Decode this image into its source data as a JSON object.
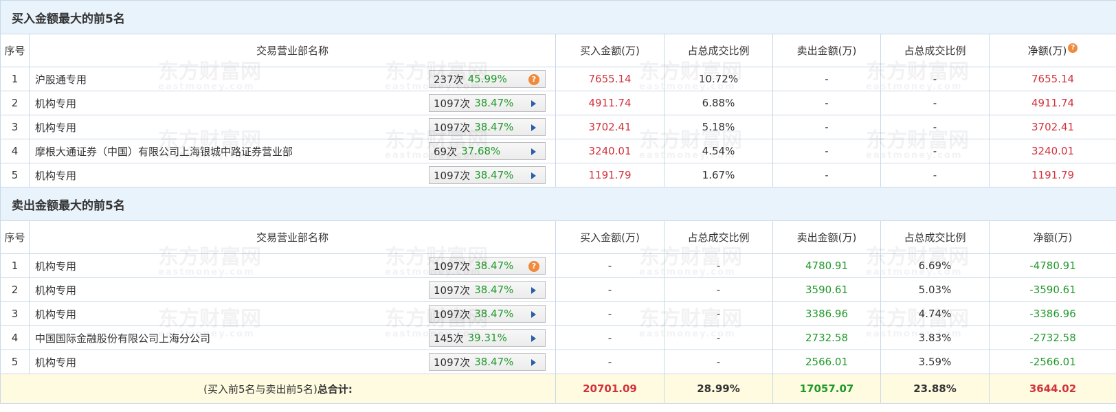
{
  "buy_section": {
    "title": "买入金额最大的前5名",
    "headers": [
      "序号",
      "交易营业部名称",
      "买入金额(万)",
      "占总成交比例",
      "卖出金额(万)",
      "占总成交比例",
      "净额(万)"
    ],
    "rows": [
      {
        "no": "1",
        "name": "沪股通专用",
        "count": "237次",
        "pct": "45.99%",
        "badge": "question",
        "buy": "7655.14",
        "buy_ratio": "10.72%",
        "sell": "-",
        "sell_ratio": "-",
        "net": "7655.14"
      },
      {
        "no": "2",
        "name": "机构专用",
        "count": "1097次",
        "pct": "38.47%",
        "badge": "arrow",
        "buy": "4911.74",
        "buy_ratio": "6.88%",
        "sell": "-",
        "sell_ratio": "-",
        "net": "4911.74"
      },
      {
        "no": "3",
        "name": "机构专用",
        "count": "1097次",
        "pct": "38.47%",
        "badge": "arrow",
        "buy": "3702.41",
        "buy_ratio": "5.18%",
        "sell": "-",
        "sell_ratio": "-",
        "net": "3702.41"
      },
      {
        "no": "4",
        "name": "摩根大通证券（中国）有限公司上海银城中路证券营业部",
        "count": "69次",
        "pct": "37.68%",
        "badge": "arrow",
        "buy": "3240.01",
        "buy_ratio": "4.54%",
        "sell": "-",
        "sell_ratio": "-",
        "net": "3240.01"
      },
      {
        "no": "5",
        "name": "机构专用",
        "count": "1097次",
        "pct": "38.47%",
        "badge": "arrow",
        "buy": "1191.79",
        "buy_ratio": "1.67%",
        "sell": "-",
        "sell_ratio": "-",
        "net": "1191.79"
      }
    ]
  },
  "sell_section": {
    "title": "卖出金额最大的前5名",
    "headers": [
      "序号",
      "交易营业部名称",
      "买入金额(万)",
      "占总成交比例",
      "卖出金额(万)",
      "占总成交比例",
      "净额(万)"
    ],
    "rows": [
      {
        "no": "1",
        "name": "机构专用",
        "count": "1097次",
        "pct": "38.47%",
        "badge": "question",
        "buy": "-",
        "buy_ratio": "-",
        "sell": "4780.91",
        "sell_ratio": "6.69%",
        "net": "-4780.91"
      },
      {
        "no": "2",
        "name": "机构专用",
        "count": "1097次",
        "pct": "38.47%",
        "badge": "arrow",
        "buy": "-",
        "buy_ratio": "-",
        "sell": "3590.61",
        "sell_ratio": "5.03%",
        "net": "-3590.61"
      },
      {
        "no": "3",
        "name": "机构专用",
        "count": "1097次",
        "pct": "38.47%",
        "badge": "arrow",
        "buy": "-",
        "buy_ratio": "-",
        "sell": "3386.96",
        "sell_ratio": "4.74%",
        "net": "-3386.96"
      },
      {
        "no": "4",
        "name": "中国国际金融股份有限公司上海分公司",
        "count": "145次",
        "pct": "39.31%",
        "badge": "arrow",
        "buy": "-",
        "buy_ratio": "-",
        "sell": "2732.58",
        "sell_ratio": "3.83%",
        "net": "-2732.58"
      },
      {
        "no": "5",
        "name": "机构专用",
        "count": "1097次",
        "pct": "38.47%",
        "badge": "arrow",
        "buy": "-",
        "buy_ratio": "-",
        "sell": "2566.01",
        "sell_ratio": "3.59%",
        "net": "-2566.01"
      }
    ]
  },
  "total": {
    "label_prefix": "(买入前5名与卖出前5名)",
    "label_bold": "总合计:",
    "buy": "20701.09",
    "buy_ratio": "28.99%",
    "sell": "17057.07",
    "sell_ratio": "23.88%",
    "net": "3644.02"
  },
  "watermark": {
    "cn": "东方财富网",
    "en": "eastmoney.com"
  },
  "colors": {
    "accent_red": "#d2323b",
    "accent_green": "#1f9a2a",
    "header_bg": "#e9f3fb",
    "total_bg": "#fffbe0"
  }
}
